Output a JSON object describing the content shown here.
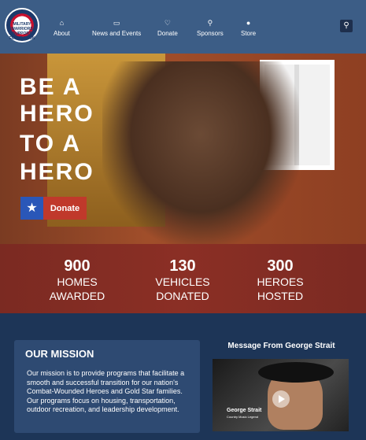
{
  "nav": {
    "logo": "MILITARY WARRIORS SUPPORT FOUNDATION",
    "items": [
      {
        "label": "About",
        "icon": "home-icon"
      },
      {
        "label": "News and Events",
        "icon": "document-icon"
      },
      {
        "label": "Donate",
        "icon": "heart-icon"
      },
      {
        "label": "Sponsors",
        "icon": "trophy-icon"
      },
      {
        "label": "Store",
        "icon": "store-icon"
      }
    ],
    "search_icon": "search-icon"
  },
  "hero": {
    "lines": [
      "BE A",
      "HERO",
      "TO A",
      "HERO"
    ],
    "donate_label": "Donate",
    "donate_icon": "star-icon"
  },
  "stats": [
    {
      "num": "900",
      "line1": "HOMES",
      "line2": "AWARDED"
    },
    {
      "num": "130",
      "line1": "VEHICLES",
      "line2": "DONATED"
    },
    {
      "num": "300",
      "line1": "HEROES",
      "line2": "HOSTED"
    }
  ],
  "mission": {
    "title": "OUR MISSION",
    "text": "Our mission is to provide programs that facilitate a smooth and successful transition for our nation's Combat-Wounded Heroes and Gold Star families. Our programs focus on housing, transportation, outdoor recreation, and leadership development."
  },
  "video": {
    "title": "Message From George Strait",
    "caption_name": "George Strait",
    "caption_sub": "Country Music Legend"
  },
  "colors": {
    "nav": "#3c5d86",
    "donate": "#c0392b",
    "star": "#2a57b8",
    "page": "#1d3557"
  }
}
